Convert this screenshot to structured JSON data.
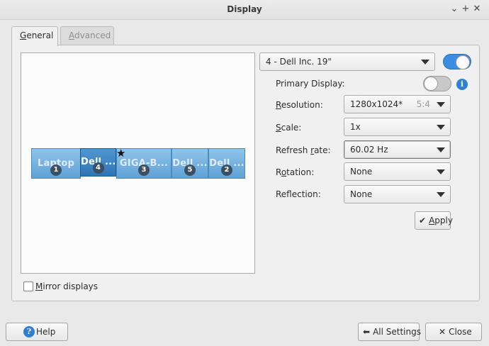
{
  "window": {
    "title": "Display",
    "controls": [
      "⌄",
      "+",
      "✕"
    ]
  },
  "tabs": [
    {
      "label": "General",
      "mnemonic": "G",
      "rest": "eneral",
      "active": true
    },
    {
      "label": "Advanced",
      "mnemonic": "A",
      "rest": "dvanced",
      "active": false
    }
  ],
  "monitors": [
    {
      "label": "Laptop",
      "number": "1",
      "selected": false
    },
    {
      "label": "Dell ...",
      "number": "4",
      "selected": true
    },
    {
      "label": "GIGA-B...",
      "number": "3",
      "selected": false,
      "primary": true
    },
    {
      "label": "Dell ...",
      "number": "5",
      "selected": false
    },
    {
      "label": "Dell ...",
      "number": "2",
      "selected": false
    }
  ],
  "display_selector": {
    "value": "4 - Dell Inc. 19\"",
    "enabled": true
  },
  "settings": {
    "primary_display": {
      "label": "Primary Display:",
      "value": false
    },
    "resolution": {
      "label": "Resolution:",
      "mnemonic": "R",
      "rest": "esolution:",
      "value": "1280x1024*",
      "aspect": "5:4"
    },
    "scale": {
      "label": "Scale:",
      "mnemonic": "S",
      "rest": "cale:",
      "value": "1x"
    },
    "refresh_rate": {
      "label": "Refresh rate:",
      "pre": "Refresh ",
      "mnemonic": "r",
      "rest": "ate:",
      "value": "60.02 Hz"
    },
    "rotation": {
      "label": "Rotation:",
      "mnemonic": "o",
      "pre": "R",
      "rest": "tation:",
      "value": "None"
    },
    "reflection": {
      "label": "Reflection:",
      "value": "None"
    }
  },
  "apply_button": {
    "label": "Apply",
    "mnemonic": "A",
    "rest": "pply"
  },
  "mirror": {
    "label": "Mirror displays",
    "mnemonic": "M",
    "rest": "irror displays",
    "checked": false
  },
  "footer": {
    "help": "Help",
    "all_settings": "All Settings",
    "close": "Close"
  },
  "colors": {
    "accent": "#3a8de0",
    "monitor": "#6aaee0",
    "monitor_selected": "#3f86c6"
  }
}
